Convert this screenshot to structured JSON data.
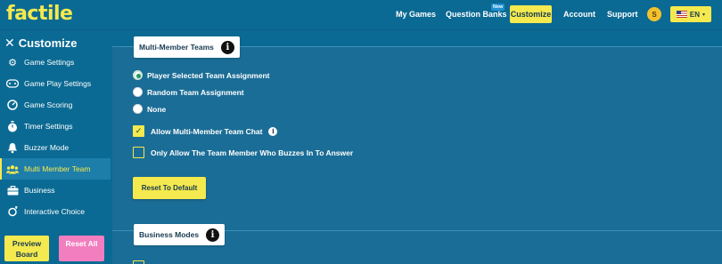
{
  "app": {
    "logo": "factile"
  },
  "nav": {
    "my_games": "My Games",
    "question_banks": "Question Banks",
    "new_badge": "New",
    "customize": "Customize",
    "account": "Account",
    "support": "Support",
    "coin": "S",
    "language": "EN"
  },
  "sidebar": {
    "title": "Customize",
    "items": [
      {
        "label": "Game Settings",
        "icon": "gear-icon"
      },
      {
        "label": "Game Play Settings",
        "icon": "gamepad-icon"
      },
      {
        "label": "Game Scoring",
        "icon": "gauge-icon"
      },
      {
        "label": "Timer Settings",
        "icon": "stopwatch-icon"
      },
      {
        "label": "Buzzer Mode",
        "icon": "bell-icon"
      },
      {
        "label": "Multi Member Team",
        "icon": "users-icon",
        "active": true
      },
      {
        "label": "Business",
        "icon": "briefcase-icon"
      },
      {
        "label": "Interactive Choice",
        "icon": "interactive-icon"
      }
    ],
    "preview_board": "Preview Board",
    "reset_all": "Reset All"
  },
  "multi_member": {
    "title": "Multi-Member Teams",
    "options": [
      {
        "label": "Player Selected Team Assignment",
        "checked": true
      },
      {
        "label": "Random Team Assignment",
        "checked": false
      },
      {
        "label": "None",
        "checked": false
      }
    ],
    "allow_chat": {
      "label": "Allow Multi-Member Team Chat",
      "checked": true
    },
    "only_buzzer": {
      "label": "Only Allow The Team Member Who Buzzes In To Answer",
      "checked": false
    },
    "reset_default": "Reset To Default"
  },
  "business": {
    "title": "Business Modes"
  },
  "colors": {
    "accent": "#f4e94e",
    "background": "#0b6a93",
    "reset_all": "#f27ec0"
  }
}
